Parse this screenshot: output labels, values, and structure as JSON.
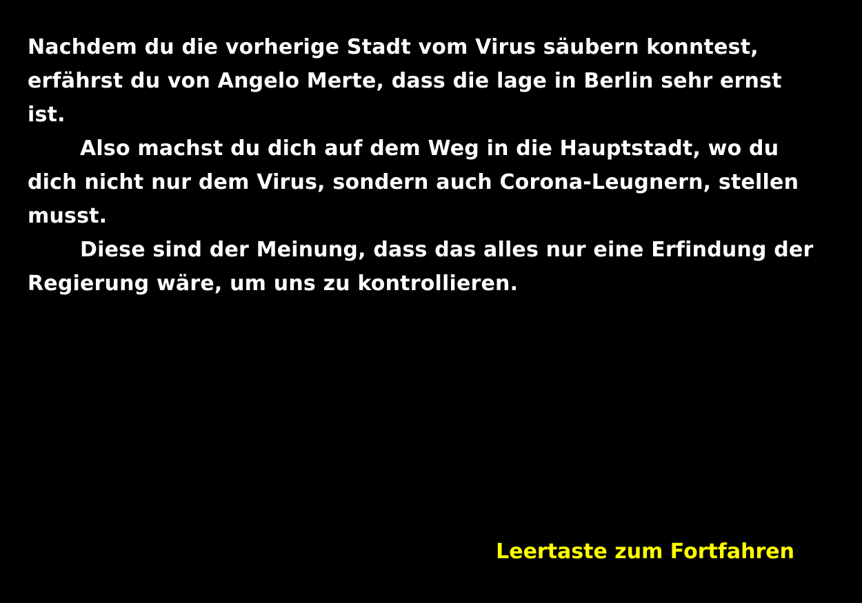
{
  "story": {
    "paragraphs": [
      "Nachdem du die vorherige Stadt vom Virus säubern konntest, erfährst du von Angelo Merte, dass die lage in Berlin sehr ernst ist.",
      "Also machst du dich auf dem Weg in die Hauptstadt, wo du dich nicht nur dem Virus, sondern auch Corona-Leugnern, stellen musst.",
      "Diese sind der Meinung, dass das alles nur eine Erfindung der Regierung wäre, um uns zu kontrollieren."
    ]
  },
  "prompt": {
    "label": "Leertaste zum Fortfahren"
  },
  "colors": {
    "background": "#000000",
    "story_text": "#ffffff",
    "prompt_text": "#ffff00"
  }
}
